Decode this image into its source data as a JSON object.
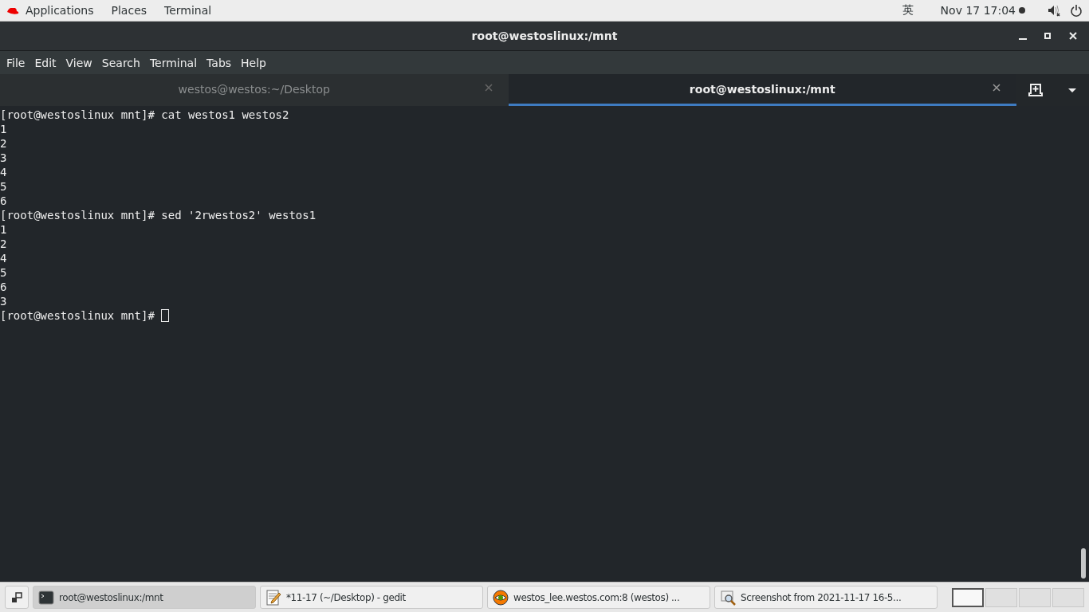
{
  "top_bar": {
    "menus": [
      "Applications",
      "Places",
      "Terminal"
    ],
    "input_method": "英",
    "clock": "Nov 17  17:04"
  },
  "window": {
    "title": "root@westoslinux:/mnt"
  },
  "menu_bar": [
    "File",
    "Edit",
    "View",
    "Search",
    "Terminal",
    "Tabs",
    "Help"
  ],
  "tabs": [
    {
      "label": "westos@westos:~/Desktop",
      "selected": false
    },
    {
      "label": "root@westoslinux:/mnt",
      "selected": true
    }
  ],
  "terminal": {
    "lines": [
      "[root@westoslinux mnt]# cat westos1 westos2",
      "1",
      "2",
      "3",
      "4",
      "5",
      "6",
      "[root@westoslinux mnt]# sed '2rwestos2' westos1",
      "1",
      "2",
      "4",
      "5",
      "6",
      "3",
      "[root@westoslinux mnt]# "
    ],
    "cursor": true
  },
  "taskbar": {
    "windows": [
      {
        "label": "root@westoslinux:/mnt",
        "kind": "terminal",
        "selected": true
      },
      {
        "label": "*11-17 (~/Desktop) - gedit",
        "kind": "editor",
        "selected": false
      },
      {
        "label": "westos_lee.westos.com:8 (westos) ...",
        "kind": "viewer",
        "selected": false
      },
      {
        "label": "Screenshot from 2021-11-17 16-5...",
        "kind": "screenshot",
        "selected": false
      }
    ],
    "workspaces": [
      {
        "selected": true
      },
      {
        "selected": false
      },
      {
        "selected": false
      },
      {
        "selected": false
      }
    ]
  }
}
